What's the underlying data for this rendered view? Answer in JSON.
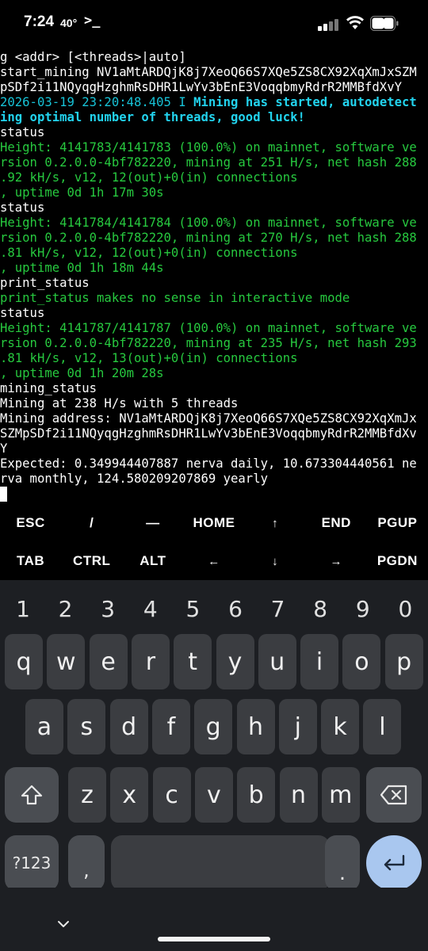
{
  "status_bar": {
    "time": "7:24",
    "temp": "40°",
    "prompt_icon": "terminal-prompt-icon"
  },
  "terminal": {
    "lines": [
      {
        "text": "g <addr> [<threads>|auto]",
        "color": "white"
      },
      {
        "text": "start_mining NV1aMtARDQjK8j7XeoQ66S7XQe5ZS8CX92XqXmJxSZM",
        "color": "white"
      },
      {
        "text": "pSDf2i11NQyqgHzghmRsDHR1LwYv3bEnE3VoqqbmyRdrR2MMBfdXvY",
        "color": "white"
      },
      {
        "text": "2026-03-19 23:20:48.405 I ",
        "color": "cyan",
        "bold_tail": "Mining has started, autodetect"
      },
      {
        "text": "",
        "color": "cyan",
        "bold_tail": "ing optimal number of threads, good luck!"
      },
      {
        "text": "status",
        "color": "white"
      },
      {
        "text": "Height: 4141783/4141783 (100.0%) on mainnet, software ve",
        "color": "green"
      },
      {
        "text": "rsion 0.2.0.0-4bf782220, mining at 251 H/s, net hash 288",
        "color": "green"
      },
      {
        "text": ".92 kH/s, v12, 12(out)+0(in) connections",
        "color": "green"
      },
      {
        "text": ", uptime 0d 1h 17m 30s",
        "color": "green"
      },
      {
        "text": "status",
        "color": "white"
      },
      {
        "text": "Height: 4141784/4141784 (100.0%) on mainnet, software ve",
        "color": "green"
      },
      {
        "text": "rsion 0.2.0.0-4bf782220, mining at 270 H/s, net hash 288",
        "color": "green"
      },
      {
        "text": ".81 kH/s, v12, 12(out)+0(in) connections",
        "color": "green"
      },
      {
        "text": ", uptime 0d 1h 18m 44s",
        "color": "green"
      },
      {
        "text": "print_status",
        "color": "white"
      },
      {
        "text": "print_status makes no sense in interactive mode",
        "color": "green"
      },
      {
        "text": "status",
        "color": "white"
      },
      {
        "text": "Height: 4141787/4141787 (100.0%) on mainnet, software ve",
        "color": "green"
      },
      {
        "text": "rsion 0.2.0.0-4bf782220, mining at 235 H/s, net hash 293",
        "color": "green"
      },
      {
        "text": ".81 kH/s, v12, 13(out)+0(in) connections",
        "color": "green"
      },
      {
        "text": ", uptime 0d 1h 20m 28s",
        "color": "green"
      },
      {
        "text": "mining_status",
        "color": "white"
      },
      {
        "text": "Mining at 238 H/s with 5 threads",
        "color": "white"
      },
      {
        "text": "Mining address: NV1aMtARDQjK8j7XeoQ66S7XQe5ZS8CX92XqXmJx",
        "color": "white"
      },
      {
        "text": "SZMpSDf2i11NQyqgHzghmRsDHR1LwYv3bEnE3VoqqbmyRdrR2MMBfdXv",
        "color": "white"
      },
      {
        "text": "Y",
        "color": "white"
      },
      {
        "text": "Expected: 0.349944407887 nerva daily, 10.673304440561 ne",
        "color": "white"
      },
      {
        "text": "rva monthly, 124.580209207869 yearly",
        "color": "white"
      }
    ]
  },
  "extra_keys": {
    "row1": [
      "ESC",
      "/",
      "—",
      "HOME",
      "↑",
      "END",
      "PGUP"
    ],
    "row2": [
      "TAB",
      "CTRL",
      "ALT",
      "←",
      "↓",
      "→",
      "PGDN"
    ]
  },
  "keyboard": {
    "numbers": [
      "1",
      "2",
      "3",
      "4",
      "5",
      "6",
      "7",
      "8",
      "9",
      "0"
    ],
    "row1": [
      "q",
      "w",
      "e",
      "r",
      "t",
      "y",
      "u",
      "i",
      "o",
      "p"
    ],
    "row2": [
      "a",
      "s",
      "d",
      "f",
      "g",
      "h",
      "j",
      "k",
      "l"
    ],
    "row3": [
      "z",
      "x",
      "c",
      "v",
      "b",
      "n",
      "m"
    ],
    "symbols_key": "?123",
    "comma_key": ",",
    "period_key": ".",
    "shift_icon": "shift-icon",
    "backspace_icon": "backspace-icon",
    "enter_icon": "enter-icon",
    "hide_icon": "chevron-down-icon"
  },
  "colors": {
    "terminal_bg": "#000000",
    "green": "#27c93f",
    "cyan": "#17c2d6",
    "keyboard_bg": "#1d1f23",
    "key_bg": "#3b3d41",
    "enter_bg": "#a9c7ef"
  }
}
